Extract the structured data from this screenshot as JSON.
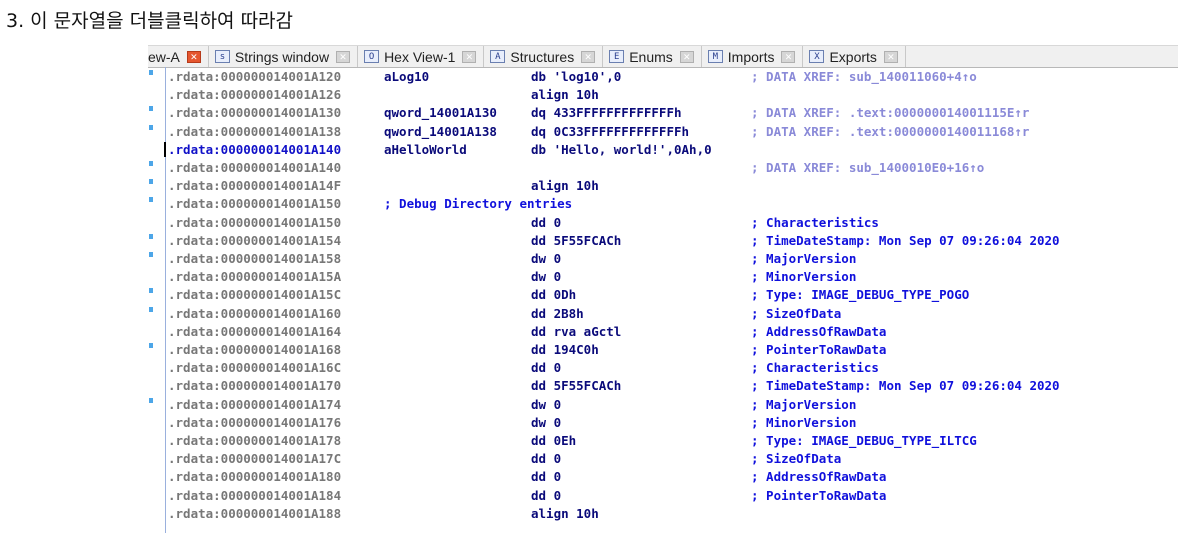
{
  "caption": "3. 이 문자열을 더블클릭하여 따라감",
  "tabs": [
    {
      "label": "ew-A",
      "icon": "",
      "active": true
    },
    {
      "label": "Strings window",
      "icon": "s"
    },
    {
      "label": "Hex View-1",
      "icon": "O"
    },
    {
      "label": "Structures",
      "icon": "A"
    },
    {
      "label": "Enums",
      "icon": "E"
    },
    {
      "label": "Imports",
      "icon": "M"
    },
    {
      "label": "Exports",
      "icon": "X"
    }
  ],
  "rows": [
    {
      "addr": ".rdata:000000014001A120",
      "label": "aLog10",
      "instr": "db 'log10',0",
      "comment": "; DATA XREF: sub_140011060+4↑o",
      "ctype": "xref",
      "dot": true
    },
    {
      "addr": ".rdata:000000014001A126",
      "label": "",
      "instr": "align 10h",
      "comment": "",
      "ctype": "",
      "dot": false
    },
    {
      "addr": ".rdata:000000014001A130",
      "label": "qword_14001A130",
      "instr": "dq 433FFFFFFFFFFFFFh",
      "comment": "; DATA XREF: .text:000000014001115E↑r",
      "ctype": "xref",
      "dot": true
    },
    {
      "addr": ".rdata:000000014001A138",
      "label": "qword_14001A138",
      "instr": "dq 0C33FFFFFFFFFFFFFh",
      "comment": "; DATA XREF: .text:0000000140011168↑r",
      "ctype": "xref",
      "dot": true
    },
    {
      "addr": ".rdata:000000014001A140",
      "label": "aHelloWorld",
      "instr": "db 'Hello, world!',0Ah,0",
      "comment": "",
      "ctype": "",
      "dot": false,
      "current": true
    },
    {
      "addr": ".rdata:000000014001A140",
      "label": "",
      "instr": "",
      "comment": "; DATA XREF: sub_1400010E0+16↑o",
      "ctype": "xref",
      "dot": true
    },
    {
      "addr": ".rdata:000000014001A14F",
      "label": "",
      "instr": "align 10h",
      "comment": "",
      "ctype": "",
      "dot": true
    },
    {
      "addr": ".rdata:000000014001A150",
      "label": "",
      "instr": "",
      "comment": "; Debug Directory entries",
      "ctype": "hdr",
      "dot": true
    },
    {
      "addr": ".rdata:000000014001A150",
      "label": "",
      "instr": "dd 0",
      "comment": "; Characteristics",
      "ctype": "",
      "dot": false
    },
    {
      "addr": ".rdata:000000014001A154",
      "label": "",
      "instr": "dd 5F55FCACh",
      "comment": "; TimeDateStamp: Mon Sep 07 09:26:04 2020",
      "ctype": "",
      "dot": true
    },
    {
      "addr": ".rdata:000000014001A158",
      "label": "",
      "instr": "dw 0",
      "comment": "; MajorVersion",
      "ctype": "",
      "dot": true
    },
    {
      "addr": ".rdata:000000014001A15A",
      "label": "",
      "instr": "dw 0",
      "comment": "; MinorVersion",
      "ctype": "",
      "dot": false
    },
    {
      "addr": ".rdata:000000014001A15C",
      "label": "",
      "instr": "dd 0Dh",
      "comment": "; Type: IMAGE_DEBUG_TYPE_POGO",
      "ctype": "",
      "dot": true
    },
    {
      "addr": ".rdata:000000014001A160",
      "label": "",
      "instr": "dd 2B8h",
      "comment": "; SizeOfData",
      "ctype": "",
      "dot": true
    },
    {
      "addr": ".rdata:000000014001A164",
      "label": "",
      "instr": "dd rva aGctl",
      "comment": "; AddressOfRawData",
      "ctype": "",
      "dot": false
    },
    {
      "addr": ".rdata:000000014001A168",
      "label": "",
      "instr": "dd 194C0h",
      "comment": "; PointerToRawData",
      "ctype": "",
      "dot": true
    },
    {
      "addr": ".rdata:000000014001A16C",
      "label": "",
      "instr": "dd 0",
      "comment": "; Characteristics",
      "ctype": "",
      "dot": false
    },
    {
      "addr": ".rdata:000000014001A170",
      "label": "",
      "instr": "dd 5F55FCACh",
      "comment": "; TimeDateStamp: Mon Sep 07 09:26:04 2020",
      "ctype": "",
      "dot": false
    },
    {
      "addr": ".rdata:000000014001A174",
      "label": "",
      "instr": "dw 0",
      "comment": "; MajorVersion",
      "ctype": "",
      "dot": true
    },
    {
      "addr": ".rdata:000000014001A176",
      "label": "",
      "instr": "dw 0",
      "comment": "; MinorVersion",
      "ctype": "",
      "dot": false
    },
    {
      "addr": ".rdata:000000014001A178",
      "label": "",
      "instr": "dd 0Eh",
      "comment": "; Type: IMAGE_DEBUG_TYPE_ILTCG",
      "ctype": "",
      "dot": false
    },
    {
      "addr": ".rdata:000000014001A17C",
      "label": "",
      "instr": "dd 0",
      "comment": "; SizeOfData",
      "ctype": "",
      "dot": false
    },
    {
      "addr": ".rdata:000000014001A180",
      "label": "",
      "instr": "dd 0",
      "comment": "; AddressOfRawData",
      "ctype": "",
      "dot": false
    },
    {
      "addr": ".rdata:000000014001A184",
      "label": "",
      "instr": "dd 0",
      "comment": "; PointerToRawData",
      "ctype": "",
      "dot": false
    },
    {
      "addr": ".rdata:000000014001A188",
      "label": "",
      "instr": "align 10h",
      "comment": "",
      "ctype": "",
      "dot": false
    }
  ],
  "colors": {
    "address": "#777777",
    "current_address": "#1010c8",
    "label": "#0a0a7a",
    "comment": "#1010dc",
    "xref_comment": "#8a8ad8",
    "marker": "#4da6e8",
    "close_active": "#e5562f"
  }
}
